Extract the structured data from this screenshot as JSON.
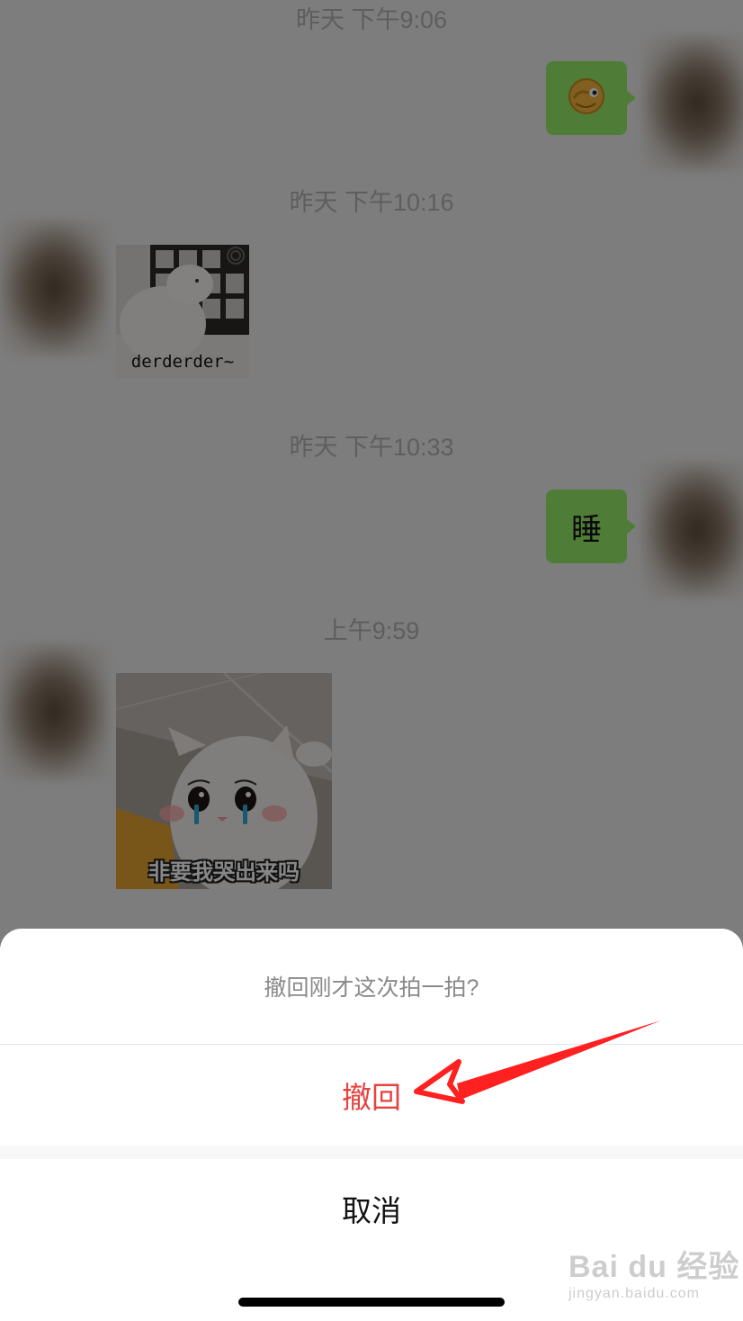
{
  "chat": {
    "timestamps": [
      "昨天 下午9:06",
      "昨天 下午10:16",
      "昨天 下午10:33",
      "上午9:59"
    ],
    "messages": [
      {
        "side": "right",
        "type": "emoji",
        "icon": "winking-face-emoji-icon"
      },
      {
        "side": "left",
        "type": "sticker",
        "caption": "derderder~"
      },
      {
        "side": "right",
        "type": "text",
        "text": "睡"
      },
      {
        "side": "left",
        "type": "sticker",
        "caption": "非要我哭出来吗"
      }
    ]
  },
  "action_sheet": {
    "prompt": "撤回刚才这次拍一拍?",
    "confirm_label": "撤回",
    "cancel_label": "取消",
    "confirm_color": "#e64340"
  },
  "annotation": {
    "arrow_color": "#ff2020"
  },
  "watermark": {
    "brand": "Bai du 经验",
    "url": "jingyan.baidu.com"
  }
}
